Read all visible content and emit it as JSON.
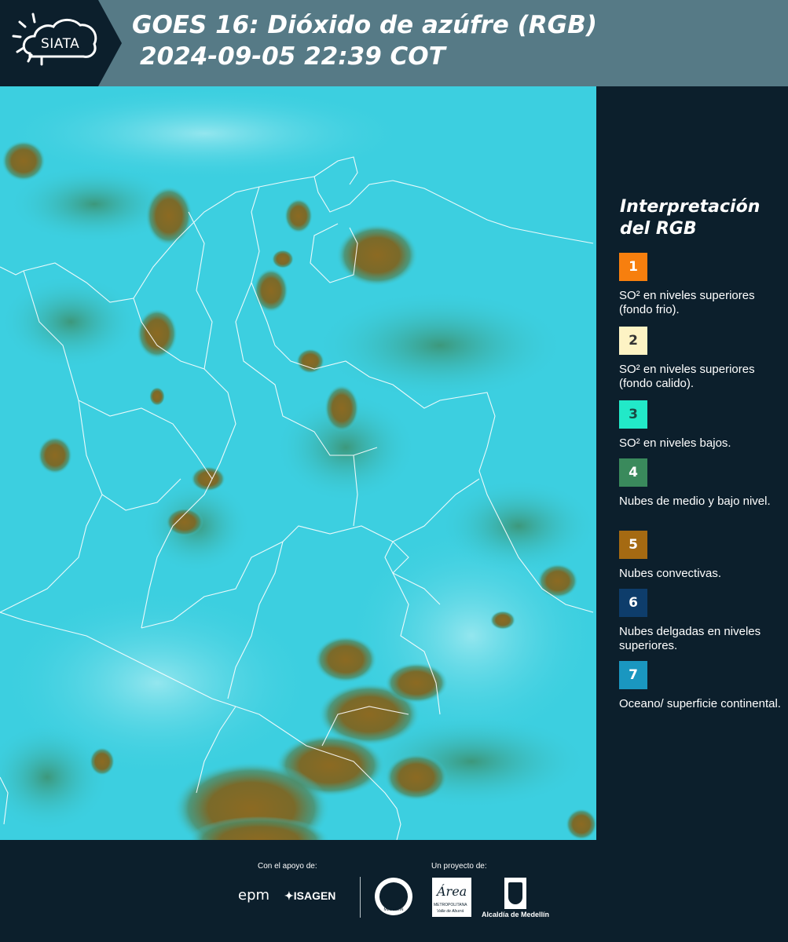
{
  "header": {
    "logo_text": "SIATA",
    "title_line1": "GOES 16: Dióxido de azúfre (RGB)",
    "title_line2": "2024-09-05 22:39 COT"
  },
  "legend": {
    "title": "Interpretación del RGB",
    "items": [
      {
        "number": "1",
        "color": "#f77f0e",
        "text_color": "#ffffff",
        "label": "SO² en niveles superiores (fondo frio)."
      },
      {
        "number": "2",
        "color": "#fdf3c4",
        "text_color": "#333333",
        "label": "SO² en niveles superiores (fondo calido)."
      },
      {
        "number": "3",
        "color": "#22e9c8",
        "text_color": "#1a4a44",
        "label": "SO² en niveles bajos."
      },
      {
        "number": "4",
        "color": "#3a8a5c",
        "text_color": "#ffffff",
        "label": "Nubes de medio y bajo nivel."
      },
      {
        "number": "5",
        "color": "#a56a12",
        "text_color": "#ffffff",
        "label": "Nubes convectivas."
      },
      {
        "number": "6",
        "color": "#0e3d6b",
        "text_color": "#ffffff",
        "label": "Nubes delgadas en niveles superiores."
      },
      {
        "number": "7",
        "color": "#1a97c0",
        "text_color": "#ffffff",
        "label": "Oceano/ superficie continental."
      }
    ]
  },
  "footer": {
    "support_label": "Con el apoyo de:",
    "project_label": "Un proyecto de:",
    "epm_logo": "epm",
    "isagen_logo": "ISAGEN",
    "area_logo_word": "Área",
    "area_logo_sub1": "METROPOLITANA",
    "area_logo_sub2": "Valle de Aburrá",
    "alcaldia_logo": "Alcaldía de Medellín",
    "seal_logo": "MEDELLÍN"
  },
  "map": {
    "background_color": "#3ccfe0",
    "cloud_color": "#8a6a2a",
    "border_color": "#ffffff"
  }
}
